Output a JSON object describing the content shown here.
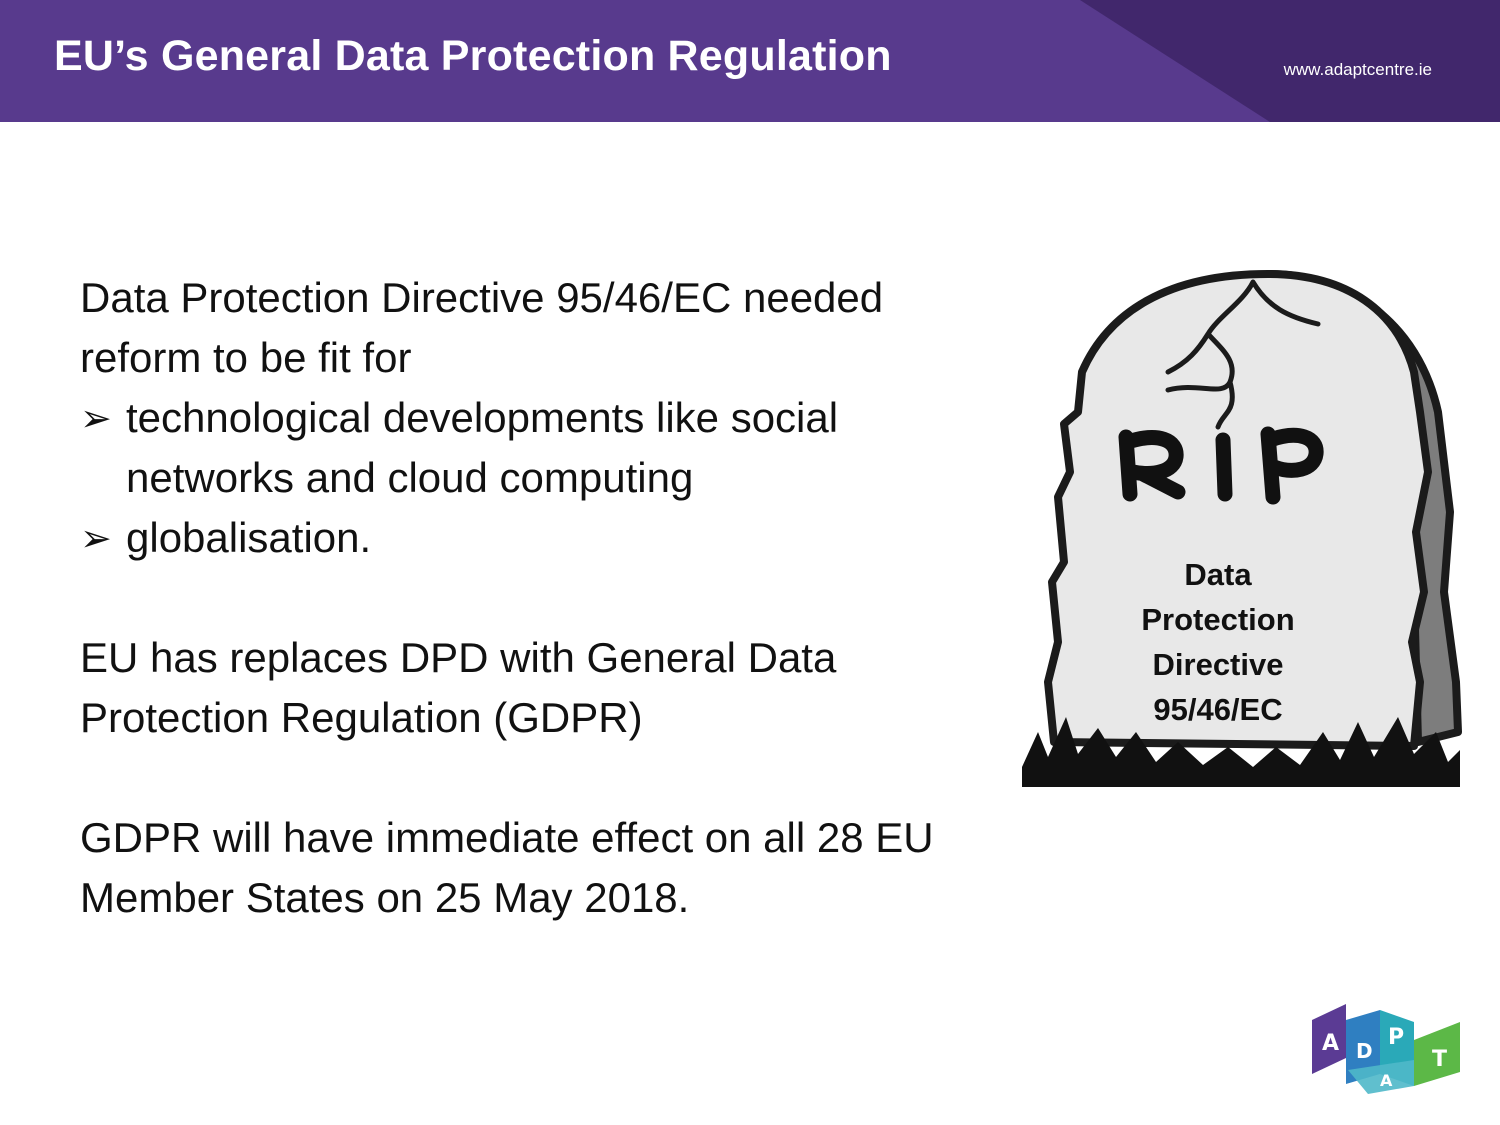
{
  "header": {
    "title": "EU’s General Data Protection Regulation",
    "url": "www.adaptcentre.ie"
  },
  "content": {
    "intro": "Data Protection Directive 95/46/EC needed reform to be fit for",
    "bullets": [
      "technological developments like social networks and cloud computing",
      "globalisation."
    ],
    "paragraph2": "EU has replaces DPD with General Data Protection Regulation (GDPR)",
    "paragraph3": "GDPR will have immediate effect on all 28 EU Member States on 25 May 2018."
  },
  "tombstone": {
    "heading": "RIP",
    "lines": [
      "Data",
      "Protection",
      "Directive",
      "95/46/EC"
    ]
  },
  "logo": {
    "letters": [
      "A",
      "D",
      "P",
      "A",
      "T"
    ]
  },
  "colors": {
    "header_bg": "#583a8d",
    "logo_purple": "#5b3b94",
    "logo_blue": "#2f7fc1",
    "logo_teal": "#2aa9b8",
    "logo_green": "#5cb847"
  },
  "icons": [
    "bullet-arrow-icon",
    "tombstone-illustration",
    "adapt-logo"
  ]
}
